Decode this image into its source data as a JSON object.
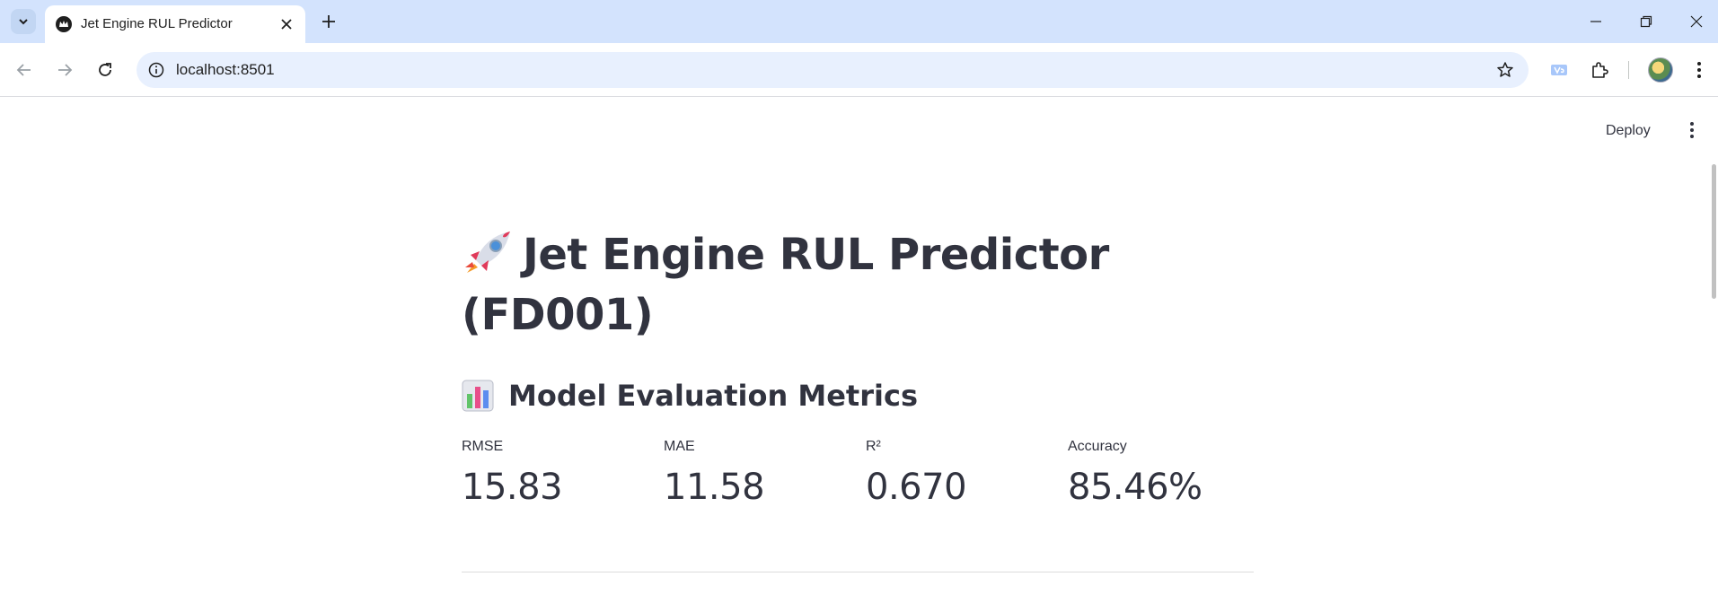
{
  "browser": {
    "tab_title": "Jet Engine RUL Predictor",
    "url": "localhost:8501",
    "icons": {
      "tab_list": "chevron-down-icon",
      "favicon": "streamlit-crown-icon",
      "close": "close-icon",
      "new_tab": "plus-icon",
      "back": "arrow-left-icon",
      "forward": "arrow-right-icon",
      "reload": "reload-icon",
      "site_info": "info-icon",
      "bookmark": "star-icon",
      "extensions": "puzzle-icon",
      "menu": "kebab-menu-icon"
    },
    "colors": {
      "tabbar": "#d3e3fd",
      "omnibox": "#e8f0fe"
    }
  },
  "app": {
    "deploy_label": "Deploy",
    "title_emoji": "rocket-icon",
    "title": "Jet Engine RUL Predictor (FD001)",
    "section_emoji": "bar-chart-icon",
    "section_title": "Model Evaluation Metrics",
    "metrics": [
      {
        "label": "RMSE",
        "value": "15.83"
      },
      {
        "label": "MAE",
        "value": "11.58"
      },
      {
        "label": "R²",
        "value": "0.670"
      },
      {
        "label": "Accuracy",
        "value": "85.46%"
      }
    ],
    "text_color": "#31333f"
  }
}
